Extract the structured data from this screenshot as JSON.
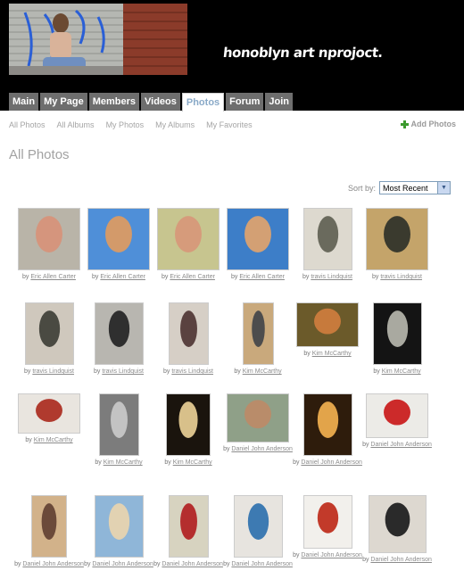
{
  "site": {
    "logo": "honoblyn art nprojoct."
  },
  "tabs": [
    "Main",
    "My Page",
    "Members",
    "Videos",
    "Photos",
    "Forum",
    "Join"
  ],
  "active_tab": "Photos",
  "subnav": [
    "All Photos",
    "All Albums",
    "My Photos",
    "My Albums",
    "My Favorites"
  ],
  "add_photos": "Add Photos",
  "page_title": "All Photos",
  "sort": {
    "label": "Sort by:",
    "value": "Most Recent"
  },
  "by": "by",
  "photos": [
    {
      "author": "Eric Allen Carter",
      "bg": "#b9b4a8",
      "fg": "#d5957d"
    },
    {
      "author": "Eric Allen Carter",
      "bg": "#4f8fd8",
      "fg": "#d39a6a"
    },
    {
      "author": "Eric Allen Carter",
      "bg": "#c7c58f",
      "fg": "#d69b7b"
    },
    {
      "author": "Eric Allen Carter",
      "bg": "#3d7ec8",
      "fg": "#d3a074"
    },
    {
      "author": "travis Lindquist",
      "bg": "#ddd9cf",
      "fg": "#6a6a5d"
    },
    {
      "author": "travis Lindquist",
      "bg": "#c4a46a",
      "fg": "#3a3a2e"
    },
    {
      "author": "travis Lindquist",
      "bg": "#cfc8bd",
      "fg": "#4a4a42"
    },
    {
      "author": "travis Lindquist",
      "bg": "#b8b6b0",
      "fg": "#2f2f2f"
    },
    {
      "author": "travis Lindquist",
      "bg": "#d6cfc6",
      "fg": "#5a4240"
    },
    {
      "author": "Kim McCarthy",
      "bg": "#c9a97c",
      "fg": "#4d4d4d"
    },
    {
      "author": "Kim McCarthy",
      "bg": "#6b5a2a",
      "fg": "#c77a3c"
    },
    {
      "author": "Kim McCarthy",
      "bg": "#141414",
      "fg": "#a9a9a0"
    },
    {
      "author": "Kim McCarthy",
      "bg": "#e9e5df",
      "fg": "#b03a2e"
    },
    {
      "author": "Kim McCarthy",
      "bg": "#7c7c7c",
      "fg": "#c3c3c3"
    },
    {
      "author": "Kim McCarthy",
      "bg": "#1a140d",
      "fg": "#d8c08a"
    },
    {
      "author": "Daniel John Anderson",
      "bg": "#8fa088",
      "fg": "#b98c6a"
    },
    {
      "author": "Daniel John Anderson",
      "bg": "#2e1c0c",
      "fg": "#e2a44a"
    },
    {
      "author": "Daniel John Anderson",
      "bg": "#ecebe7",
      "fg": "#cc2a2a"
    },
    {
      "author": "Daniel John Anderson",
      "bg": "#d2b28a",
      "fg": "#6b4a3a"
    },
    {
      "author": "Daniel John Anderson",
      "bg": "#8fb6d8",
      "fg": "#e2d2b2"
    },
    {
      "author": "Daniel John Anderson",
      "bg": "#d7d3c0",
      "fg": "#b42e2e"
    },
    {
      "author": "Daniel John Anderson",
      "bg": "#e7e4df",
      "fg": "#3d7ab2"
    },
    {
      "author": "Daniel John Anderson",
      "bg": "#f2f0ec",
      "fg": "#c23a2a"
    },
    {
      "author": "Daniel John Anderson",
      "bg": "#ddd8d0",
      "fg": "#2a2a2a"
    }
  ]
}
